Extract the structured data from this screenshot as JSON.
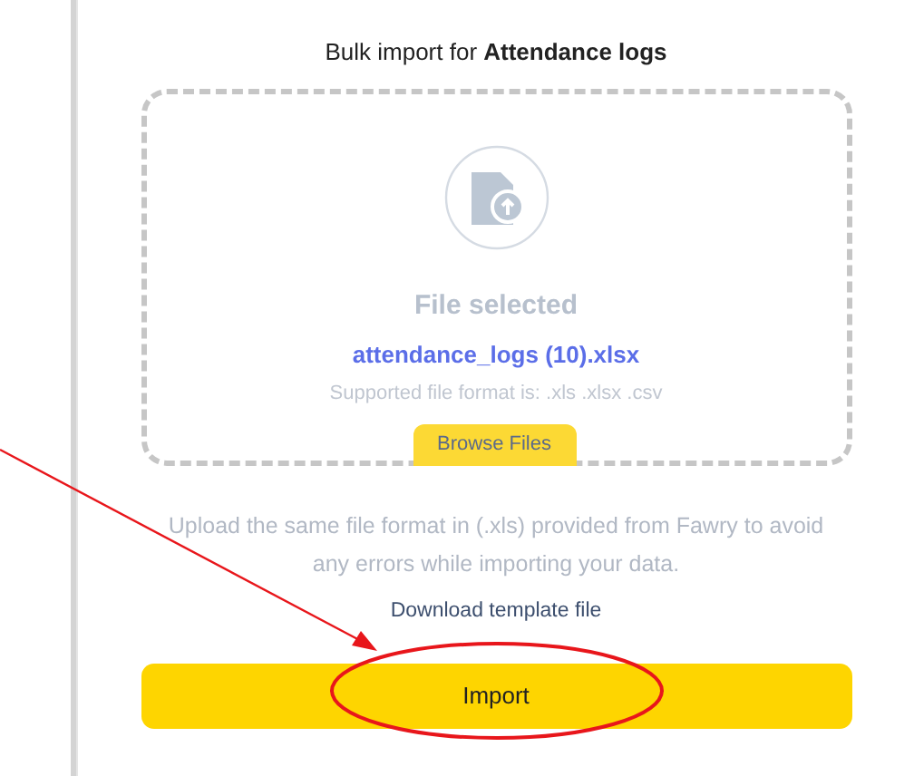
{
  "dialog": {
    "title": "Bulk import for **Attendance logs**",
    "dropzone": {
      "status": "File selected",
      "file_name": "attendance_logs (10).xlsx",
      "supported": "Supported file format is: .xls .xlsx .csv",
      "browse_button": "Browse Files"
    },
    "hint": "Upload the same file format in (.xls) provided from Fawry to avoid any errors while importing your data.",
    "template_link": "Download template file",
    "import_button": {
      "label": "Import",
      "circled": true,
      "arrow_pointing": true
    }
  }
}
